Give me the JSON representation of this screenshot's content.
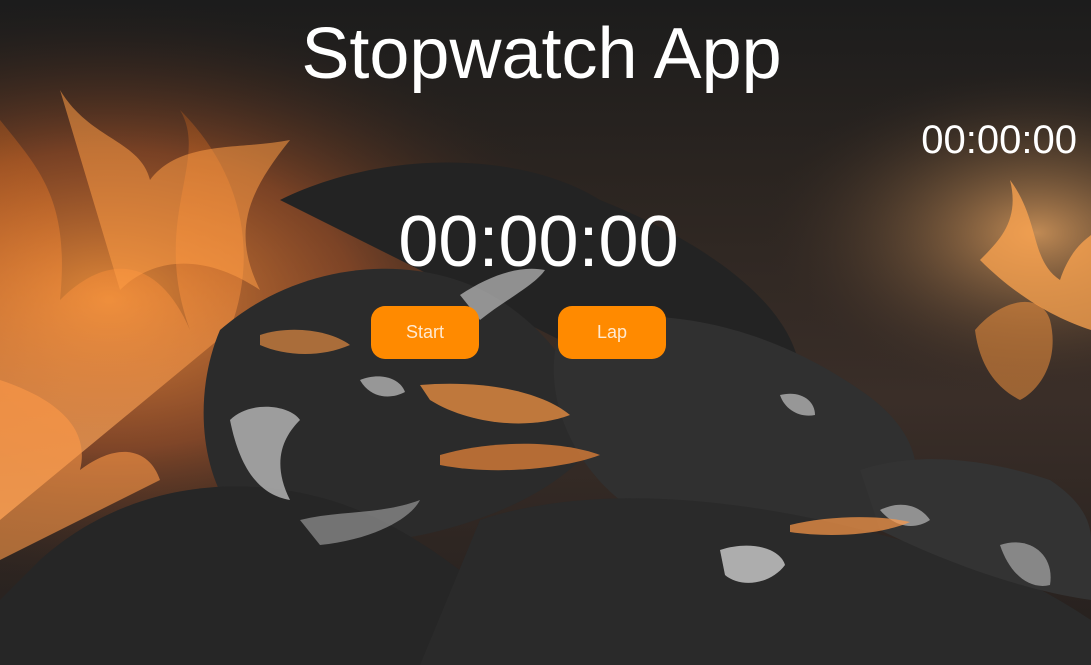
{
  "app": {
    "title": "Stopwatch App"
  },
  "timer": {
    "main_time": "00:00:00",
    "lap_time": "00:00:00"
  },
  "controls": {
    "start_label": "Start",
    "lap_label": "Lap"
  },
  "colors": {
    "button_bg": "#ff8a00",
    "text": "#ffffff",
    "flame": "#ff8a2a",
    "coal": "#2a2a2a"
  }
}
